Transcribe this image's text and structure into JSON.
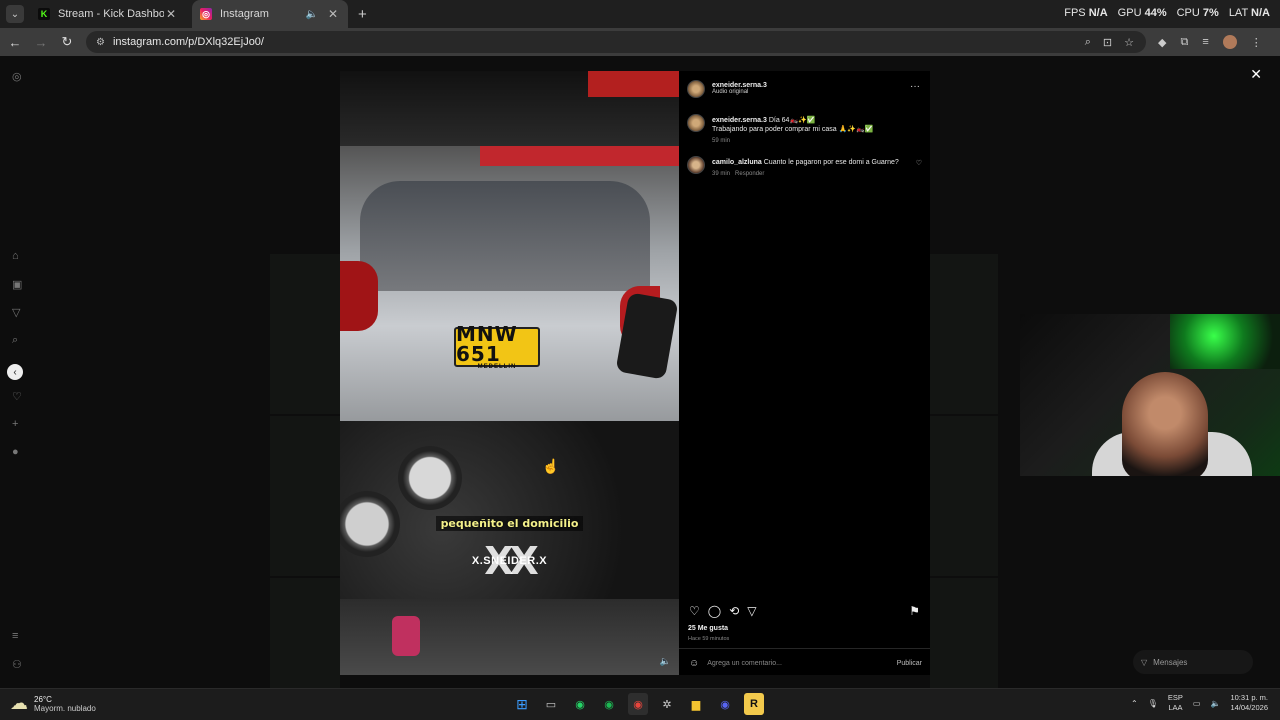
{
  "browser": {
    "tabs": [
      {
        "title": "Stream - Kick Dashboard",
        "favicon": "kick-icon",
        "active": false
      },
      {
        "title": "Instagram",
        "favicon": "instagram-icon",
        "active": true
      }
    ],
    "url": "instagram.com/p/DXlq32EjJo0/",
    "overlay": {
      "fps_label": "FPS",
      "fps_value": "N/A",
      "gpu_label": "GPU",
      "gpu_value": "44%",
      "cpu_label": "CPU",
      "cpu_value": "7%",
      "lat_label": "LAT",
      "lat_value": "N/A"
    }
  },
  "post": {
    "author": "exneider.serna.3",
    "audio": "Audio original",
    "caption_user": "exneider.serna.3",
    "caption_line1": "Día 64🏍️✨✅",
    "caption_line2": "Trabajando para poder comprar mi casa 🙏✨🏍️✅",
    "caption_time": "59 min",
    "comments": [
      {
        "user": "camilo_alzluna",
        "text": "Cuanto le pagaron por ese domi a Guarne?",
        "time": "39 min",
        "reply": "Responder"
      }
    ],
    "likes": "25 Me gusta",
    "posted_ago": "Hace 59 minutos",
    "comment_placeholder": "Agrega un comentario...",
    "publish_label": "Publicar"
  },
  "video": {
    "plate_number": "MNW 651",
    "plate_city": "MEDELLIN",
    "subtitle": "pequeñito el domicilio",
    "watermark": "X.SNEIDER.X"
  },
  "messages_label": "Mensajes",
  "taskbar": {
    "temp": "26°C",
    "weather": "Mayorm. nublado",
    "lang_1": "ESP",
    "lang_2": "LAA",
    "time": "10:31 p. m.",
    "date": "14/04/2026"
  }
}
